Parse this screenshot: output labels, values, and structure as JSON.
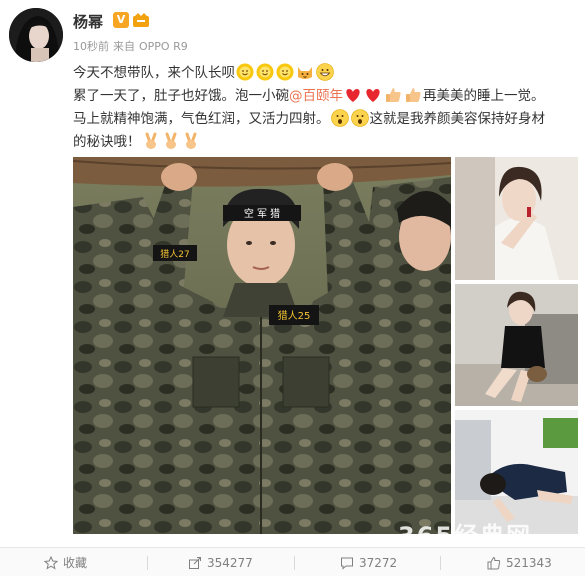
{
  "post": {
    "author": "杨幂",
    "time": "10秒前",
    "source_prefix": "来自",
    "source_device": "OPPO R9",
    "line1": "今天不想带队，来个队长呗",
    "line2_a": "累了一天了，肚子也好饿。泡一小碗",
    "mention": "@百颐年",
    "line2_b": "再美美的睡上一觉。",
    "line3_a": "马上就精神饱满，气色红润，又活力四射。",
    "line3_b": "这就是我养颜美容保持好身材",
    "line4": "的秘诀哦！",
    "vip_badge": "V"
  },
  "photo": {
    "headband_text": "空 军 猎",
    "patch_text": "猎人25",
    "patch_left_text": "猎人27"
  },
  "watermark": "365经典网",
  "footer": {
    "favorite_label": "收藏",
    "share_count": "354277",
    "comment_count": "37272",
    "like_count": "521343"
  },
  "colors": {
    "mention": "#eb7350",
    "meta": "#999999",
    "badge": "#f6a623"
  }
}
